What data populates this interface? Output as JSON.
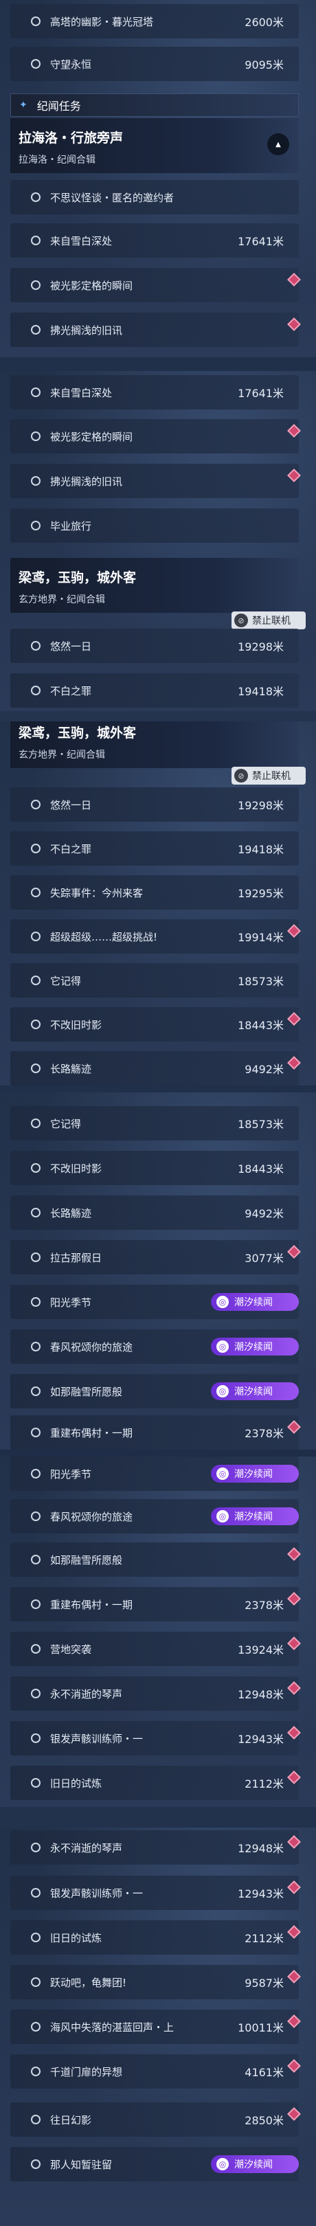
{
  "panels": [
    {
      "rows": [
        {
          "title": "高塔的幽影・暮光冠塔",
          "dist": "2600米"
        },
        {
          "title": "守望永恒",
          "dist": "9095米"
        }
      ],
      "section": "纪闻任务",
      "header": {
        "title": "拉海洛・行旅旁声",
        "sub": "拉海洛・纪闻合辑"
      },
      "rows2": [
        {
          "title": "不思议怪谈・匿名的邀约者",
          "dist": ""
        },
        {
          "title": "来自雪白深处",
          "dist": "17641米"
        },
        {
          "title": "被光影定格的瞬间",
          "dist": ""
        },
        {
          "title": "拂光搁浅的旧讯",
          "dist": ""
        }
      ]
    },
    {
      "rows": [
        {
          "title": "来自雪白深处",
          "dist": "17641米"
        },
        {
          "title": "被光影定格的瞬间",
          "dist": ""
        },
        {
          "title": "拂光搁浅的旧讯",
          "dist": ""
        },
        {
          "title": "毕业旅行",
          "dist": ""
        }
      ],
      "header": {
        "title": "梁鸢，玉驹，城外客",
        "sub": "玄方地界・纪闻合辑"
      },
      "ban": "禁止联机",
      "rows2": [
        {
          "title": "悠然一日",
          "dist": "19298米"
        },
        {
          "title": "不白之罪",
          "dist": "19418米"
        }
      ]
    },
    {
      "header": {
        "title": "梁鸢，玉驹，城外客",
        "sub": "玄方地界・纪闻合辑"
      },
      "ban": "禁止联机",
      "rows": [
        {
          "title": "悠然一日",
          "dist": "19298米"
        },
        {
          "title": "不白之罪",
          "dist": "19418米"
        },
        {
          "title": "失踪事件：今州来客",
          "dist": "19295米"
        },
        {
          "title": "超级超级……超级挑战!",
          "dist": "19914米"
        },
        {
          "title": "它记得",
          "dist": "18573米"
        },
        {
          "title": "不改旧时影",
          "dist": "18443米"
        },
        {
          "title": "长路觞迹",
          "dist": "9492米"
        }
      ]
    },
    {
      "rows": [
        {
          "title": "它记得",
          "dist": "18573米"
        },
        {
          "title": "不改旧时影",
          "dist": "18443米"
        },
        {
          "title": "长路觞迹",
          "dist": "9492米"
        },
        {
          "title": "拉古那假日",
          "dist": "3077米"
        },
        {
          "title": "阳光季节",
          "dist": ""
        },
        {
          "title": "春风祝颂你的旅途",
          "dist": ""
        },
        {
          "title": "如那融雪所愿般",
          "dist": ""
        },
        {
          "title": "重建布偶村・一期",
          "dist": "2378米"
        }
      ],
      "tag": "潮汐续闻"
    },
    {
      "rows": [
        {
          "title": "阳光季节",
          "dist": ""
        },
        {
          "title": "春风祝颂你的旅途",
          "dist": ""
        },
        {
          "title": "如那融雪所愿般",
          "dist": ""
        },
        {
          "title": "重建布偶村・一期",
          "dist": "2378米"
        },
        {
          "title": "营地突袭",
          "dist": "13924米"
        },
        {
          "title": "永不消逝的琴声",
          "dist": "12948米"
        },
        {
          "title": "银发声骸训练师・一",
          "dist": "12943米"
        },
        {
          "title": "旧日的试炼",
          "dist": "2112米"
        }
      ]
    },
    {
      "rows": [
        {
          "title": "永不消逝的琴声",
          "dist": "12948米"
        },
        {
          "title": "银发声骸训练师・一",
          "dist": "12943米"
        },
        {
          "title": "旧日的试炼",
          "dist": "2112米"
        },
        {
          "title": "跃动吧，龟舞团!",
          "dist": "9587米"
        },
        {
          "title": "海风中失落的湛蓝回声・上",
          "dist": "10011米"
        },
        {
          "title": "千道门扉的异想",
          "dist": "4161米"
        },
        {
          "title": "往日幻影",
          "dist": "2850米"
        },
        {
          "title": "那人知暂驻留",
          "dist": ""
        }
      ]
    }
  ],
  "tag": "潮汐续闻",
  "colors": {
    "accent": "#9a54f0",
    "diamond": "#d04870",
    "bg": "#22314a"
  }
}
